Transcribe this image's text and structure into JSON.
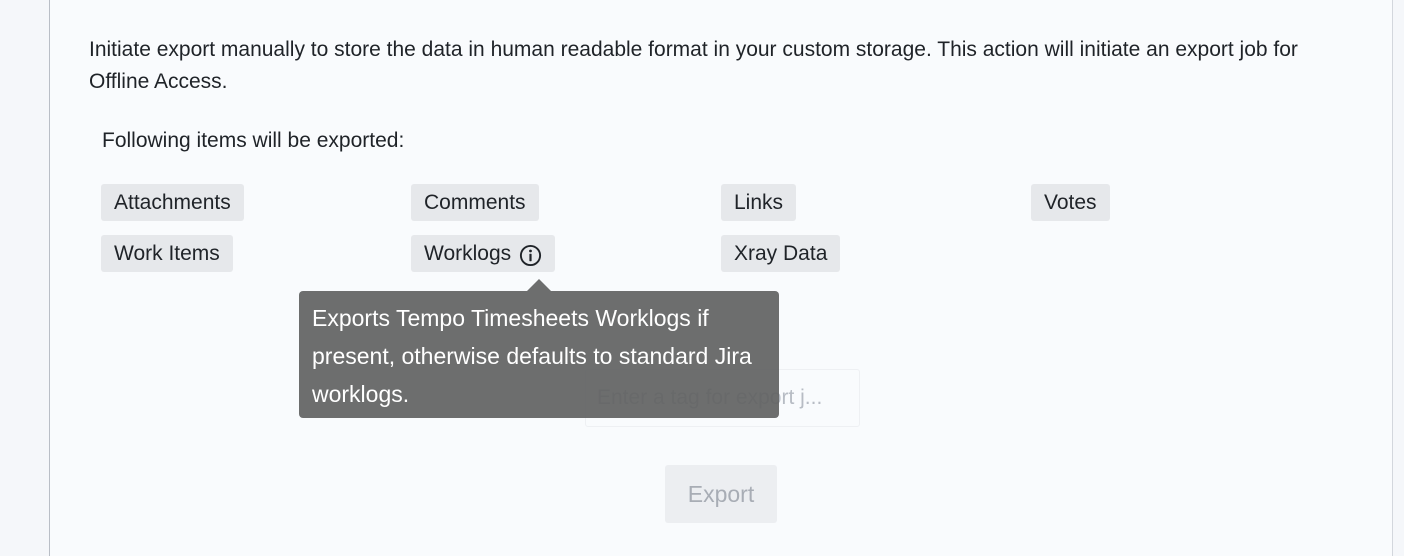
{
  "export": {
    "description": "Initiate export manually to store the data in human readable format in your custom storage. This action will initiate an export job for Offline Access.",
    "items_heading": "Following items will be exported:",
    "items": [
      {
        "label": "Attachments"
      },
      {
        "label": "Comments"
      },
      {
        "label": "Links"
      },
      {
        "label": "Votes"
      },
      {
        "label": "Work Items"
      },
      {
        "label": "Worklogs",
        "icon": "info-icon"
      },
      {
        "label": "Xray Data"
      }
    ],
    "tooltip": "Exports Tempo Timesheets Worklogs if present, otherwise defaults to standard Jira worklogs.",
    "tag_input": {
      "value": "",
      "placeholder": "Enter a tag for export j..."
    },
    "export_button_label": "Export",
    "export_button_state": "disabled"
  },
  "colors": {
    "tag_background": "#e6e8eb",
    "tooltip_background": "#626363",
    "button_disabled_background": "#eceef1",
    "button_disabled_text": "#a8adb5"
  }
}
